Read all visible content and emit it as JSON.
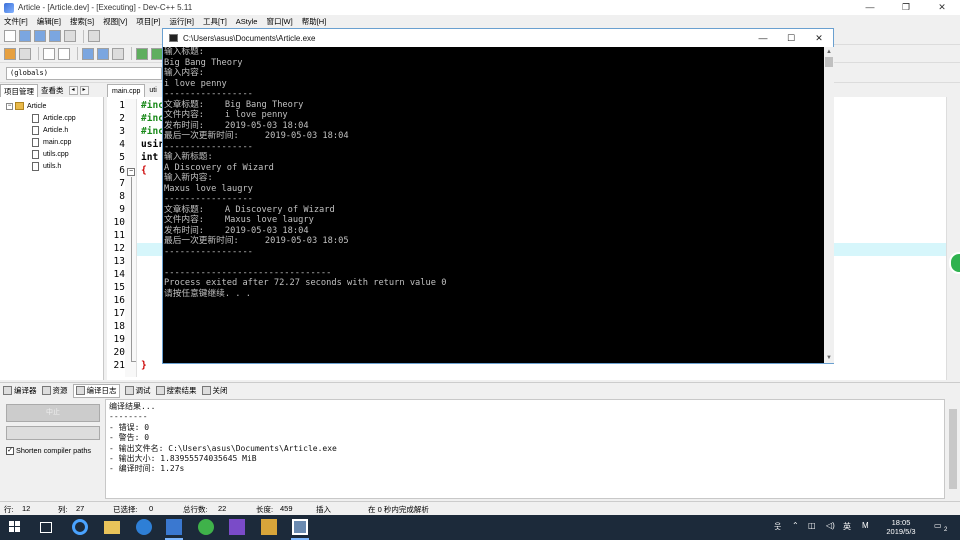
{
  "window": {
    "title": "Article - [Article.dev] - [Executing] - Dev-C++ 5.11",
    "controls": [
      "—",
      "❐",
      "✕"
    ]
  },
  "menu": [
    "文件[F]",
    "编辑[E]",
    "搜索[S]",
    "视图[V]",
    "项目[P]",
    "运行[R]",
    "工具[T]",
    "AStyle",
    "窗口[W]",
    "帮助[H]"
  ],
  "toolbar": {
    "globals": "(globals)"
  },
  "left_panel": {
    "tabs": [
      "项目管理",
      "查看类"
    ],
    "tree": {
      "root": "Article",
      "files": [
        "Article.cpp",
        "Article.h",
        "main.cpp",
        "utils.cpp",
        "utils.h"
      ]
    }
  },
  "editor": {
    "tabs": [
      "main.cpp",
      "uti"
    ],
    "line_numbers": [
      "1",
      "2",
      "3",
      "4",
      "5",
      "6",
      "7",
      "8",
      "9",
      "10",
      "11",
      "12",
      "13",
      "14",
      "15",
      "16",
      "17",
      "18",
      "19",
      "20",
      "21"
    ],
    "code": {
      "l1": "#inc",
      "l2": "#inc",
      "l3": "#inc",
      "l4": "usir",
      "l5": "int",
      "l6": "{",
      "l21": "}"
    },
    "highlight_color": "#d6f6fb"
  },
  "console": {
    "title": "C:\\Users\\asus\\Documents\\Article.exe",
    "controls": [
      "—",
      "☐",
      "✕"
    ],
    "lines": [
      "输入标题:",
      "Big Bang Theory",
      "输入内容:",
      "i love penny",
      "-----------------",
      "文章标题:    Big Bang Theory",
      "文件内容:    i love penny",
      "发布时间:    2019-05-03 18:04",
      "最后一次更新时间:     2019-05-03 18:04",
      "-----------------",
      "输入新标题:",
      "A Discovery of Wizard",
      "输入新内容:",
      "Maxus love laugry",
      "-----------------",
      "文章标题:    A Discovery of Wizard",
      "文件内容:    Maxus love laugry",
      "发布时间:    2019-05-03 18:04",
      "最后一次更新时间:     2019-05-03 18:05",
      "-----------------",
      "",
      "--------------------------------",
      "Process exited after 72.27 seconds with return value 0",
      "请按任意键继续. . ."
    ]
  },
  "bottom_tabs": [
    "编译器",
    "资源",
    "编译日志",
    "调试",
    "搜索结果",
    "关闭"
  ],
  "bottom_left": {
    "button": "中止",
    "shorten_label": "Shorten compiler paths",
    "shorten_checked": "✓"
  },
  "compile_log": [
    "编译结果...",
    "--------",
    "- 错误: 0",
    "- 警告: 0",
    "- 输出文件名: C:\\Users\\asus\\Documents\\Article.exe",
    "- 输出大小: 1.83955574035645 MiB",
    "- 编译时间: 1.27s"
  ],
  "status": {
    "row_label": "行:",
    "row": "12",
    "col_label": "列:",
    "col": "27",
    "sel_label": "已选择:",
    "sel": "0",
    "total_label": "总行数:",
    "total": "22",
    "len_label": "长度:",
    "len": "459",
    "mode": "插入",
    "parse": "在 0 秒内完成解析"
  },
  "taskbar": {
    "tray_lang": "英",
    "time": "18:05",
    "date": "2019/5/3",
    "notif_count": "2"
  },
  "colors": {
    "console_bg": "#000000",
    "console_text": "#c0c0c0",
    "taskbar": "#1c2a3a",
    "accent_green": "#2fb24f"
  }
}
